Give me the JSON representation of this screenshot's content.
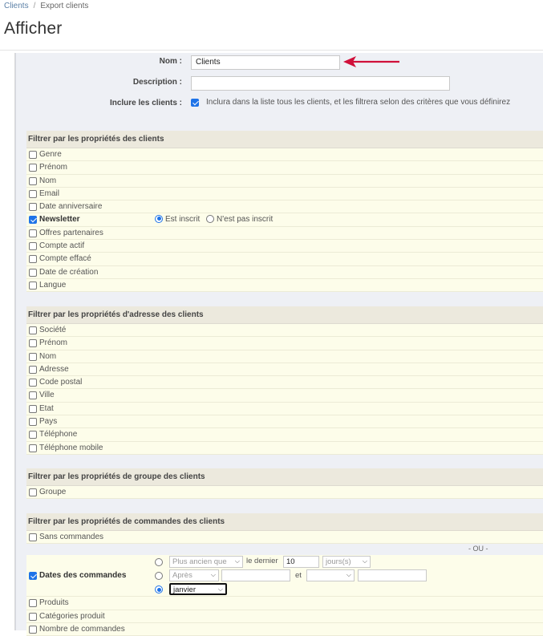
{
  "breadcrumb": {
    "root": "Clients",
    "current": "Export clients"
  },
  "page_title": "Afficher",
  "form": {
    "name_label": "Nom :",
    "name_value": "Clients",
    "description_label": "Description :",
    "description_value": "",
    "include_label": "Inclure les clients :",
    "include_checked": true,
    "include_text": "Inclura dans la liste tous les clients, et les filtrera selon des critères que vous définirez"
  },
  "sections": {
    "customer": {
      "title": "Filtrer par les propriétés des clients",
      "items": [
        "Genre",
        "Prénom",
        "Nom",
        "Email",
        "Date anniversaire",
        "Newsletter",
        "Offres partenaires",
        "Compte actif",
        "Compte effacé",
        "Date de création",
        "Langue"
      ],
      "newsletter_options": [
        "Est inscrit",
        "N'est pas inscrit"
      ]
    },
    "address": {
      "title": "Filtrer par les propriétés d'adresse des clients",
      "items": [
        "Société",
        "Prénom",
        "Nom",
        "Adresse",
        "Code postal",
        "Ville",
        "Etat",
        "Pays",
        "Téléphone",
        "Téléphone mobile"
      ]
    },
    "group": {
      "title": "Filtrer par les propriétés de groupe des clients",
      "items": [
        "Groupe"
      ]
    },
    "orders": {
      "title": "Filtrer par les propriétés de commandes des clients",
      "items": [
        "Sans commandes",
        "Dates des commandes",
        "Produits",
        "Catégories produit",
        "Nombre de commandes"
      ],
      "ou_label": "- OU -",
      "date_opt1": {
        "select": "Plus ancien que",
        "text": "le dernier",
        "number": "10",
        "unit": "jours(s)"
      },
      "date_opt2": {
        "select": "Après",
        "value1": "",
        "et": "et",
        "select2": "",
        "value2": ""
      },
      "date_opt3": {
        "select": "janvier"
      }
    }
  },
  "colors": {
    "accent": "#1e73e8",
    "arrow": "#d0103a",
    "row_bg": "#fdfdea",
    "header_bg": "#ece9dd",
    "panel_bg": "#eef0f5"
  }
}
